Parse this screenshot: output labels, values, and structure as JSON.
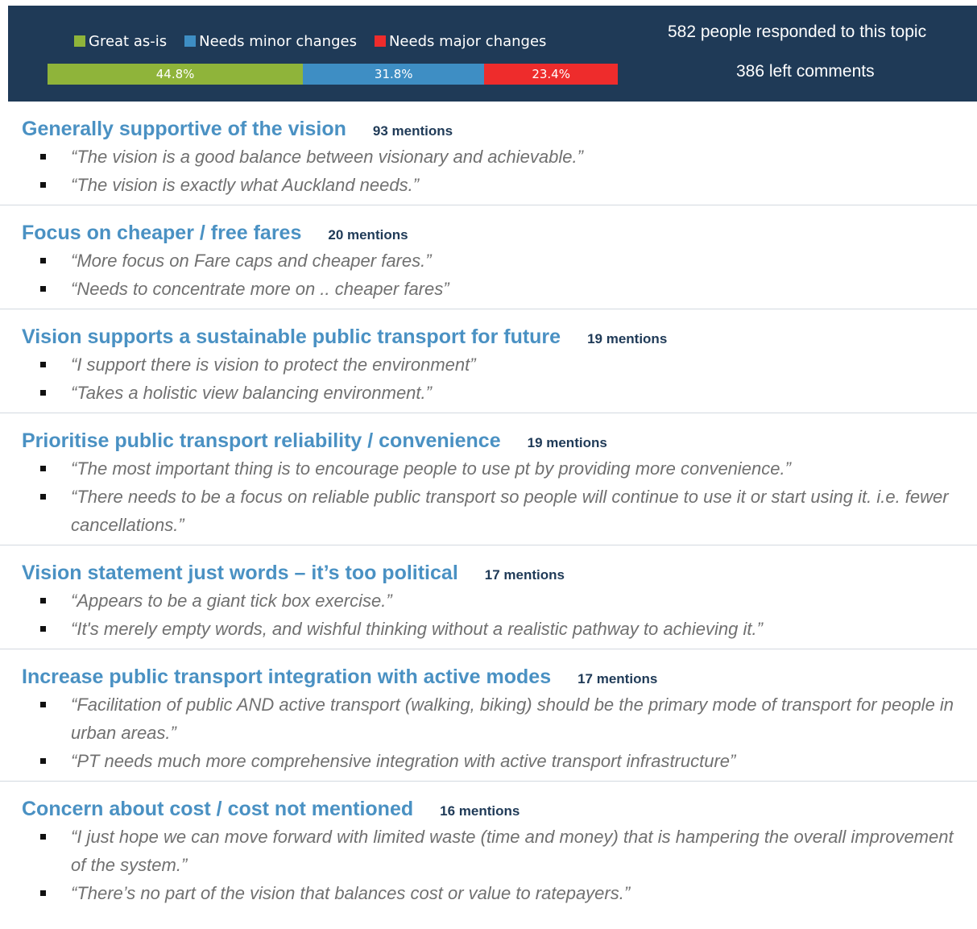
{
  "header": {
    "legend": [
      {
        "label": "Great as-is",
        "color": "#8fb43a"
      },
      {
        "label": "Needs minor changes",
        "color": "#3e8ec4"
      },
      {
        "label": "Needs major changes",
        "color": "#ee2c2c"
      }
    ],
    "bar": [
      {
        "label": "44.8%",
        "value": 44.8,
        "color": "#8fb43a"
      },
      {
        "label": "31.8%",
        "value": 31.8,
        "color": "#3e8ec4"
      },
      {
        "label": "23.4%",
        "value": 23.4,
        "color": "#ee2c2c"
      }
    ],
    "responded": "582 people responded to this topic",
    "comments": "386 left comments"
  },
  "themes": [
    {
      "title": "Generally supportive of the vision",
      "mentions": "93 mentions",
      "quotes": [
        "“The vision is a good balance between visionary and achievable.”",
        "“The vision is exactly what Auckland needs.”"
      ]
    },
    {
      "title": "Focus on cheaper / free fares",
      "mentions": "20 mentions",
      "quotes": [
        "“More focus on Fare caps and cheaper fares.”",
        "“Needs to concentrate more on .. cheaper fares”"
      ]
    },
    {
      "title": "Vision supports a sustainable public transport for future",
      "mentions": "19 mentions",
      "quotes": [
        "“I support there is vision to protect the environment”",
        "“Takes a holistic view balancing environment.”"
      ]
    },
    {
      "title": "Prioritise public transport reliability / convenience",
      "mentions": "19 mentions",
      "quotes": [
        "“The most important thing is to encourage people to use pt by providing more convenience.”",
        "“There needs to be a focus on reliable public transport so people will continue to use it or start using it. i.e. fewer cancellations.”"
      ]
    },
    {
      "title": "Vision statement just words – it’s too political",
      "mentions": "17 mentions",
      "quotes": [
        "“Appears to be a giant tick box exercise.”",
        "“It's merely empty words, and wishful thinking without a realistic pathway to achieving it.”"
      ]
    },
    {
      "title": "Increase public transport integration with active modes",
      "mentions": "17 mentions",
      "quotes": [
        "“Facilitation of public AND active transport (walking, biking) should be the primary mode of transport for people in urban areas.”",
        "“PT needs much more comprehensive integration with active transport infrastructure”"
      ]
    },
    {
      "title": "Concern about cost / cost not mentioned",
      "mentions": "16 mentions",
      "quotes": [
        "“I just hope we can move forward with limited waste (time and money) that is hampering the overall improvement of the system.”",
        "“There’s no part of the vision that balances cost or value to ratepayers.”"
      ]
    }
  ]
}
